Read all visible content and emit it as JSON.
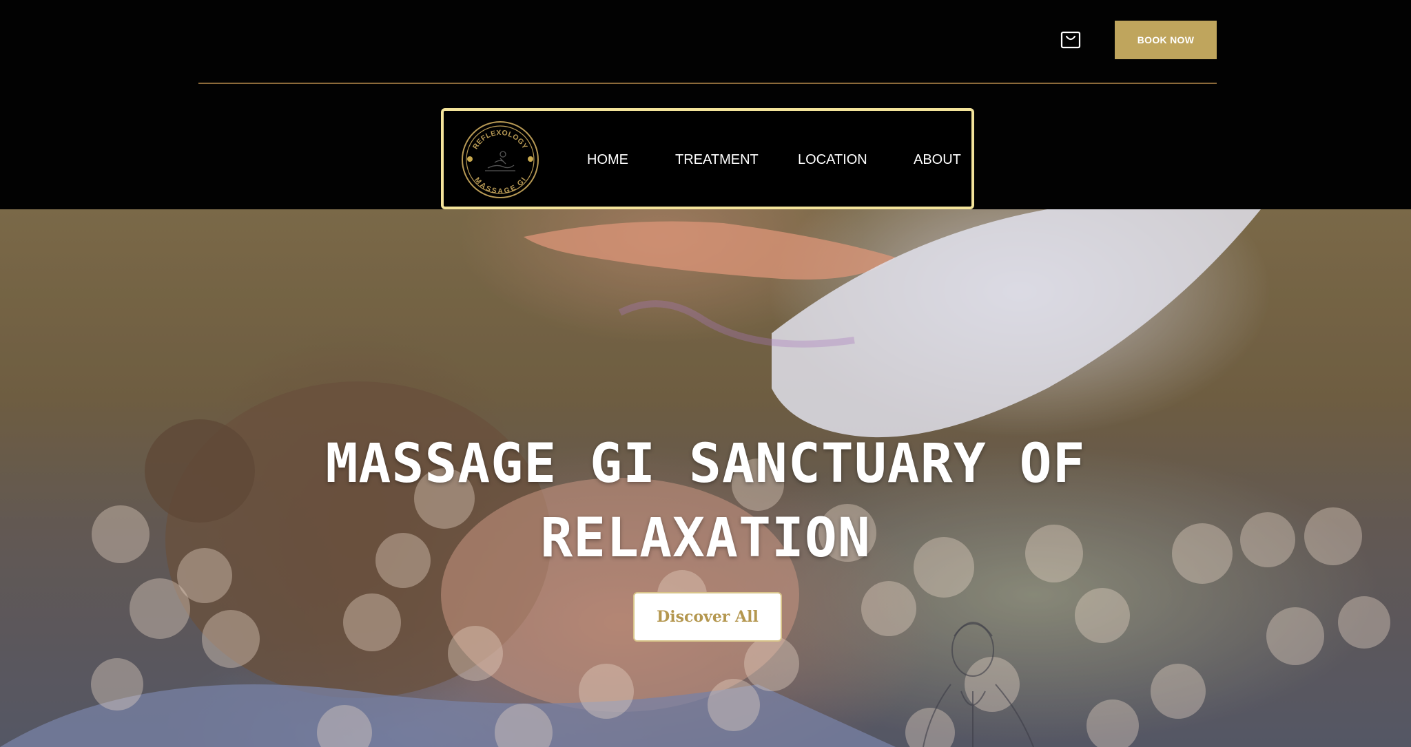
{
  "header": {
    "cart_icon": "shopping-bag-icon",
    "book_label": "BOOK NOW",
    "accent": "#bfa55d",
    "frame_color": "#f3e39a"
  },
  "logo": {
    "top_text": "REFLEXOLOGY",
    "bottom_text": "MASSAGE GI",
    "color": "#b89a55"
  },
  "nav": {
    "items": [
      {
        "label": "HOME"
      },
      {
        "label": "TREATMENT"
      },
      {
        "label": "LOCATION"
      },
      {
        "label": "ABOUT"
      }
    ]
  },
  "hero": {
    "title_line1": "MASSAGE GI SANCTUARY OF",
    "title_line2": "RELAXATION",
    "cta_label": "Discover All"
  }
}
